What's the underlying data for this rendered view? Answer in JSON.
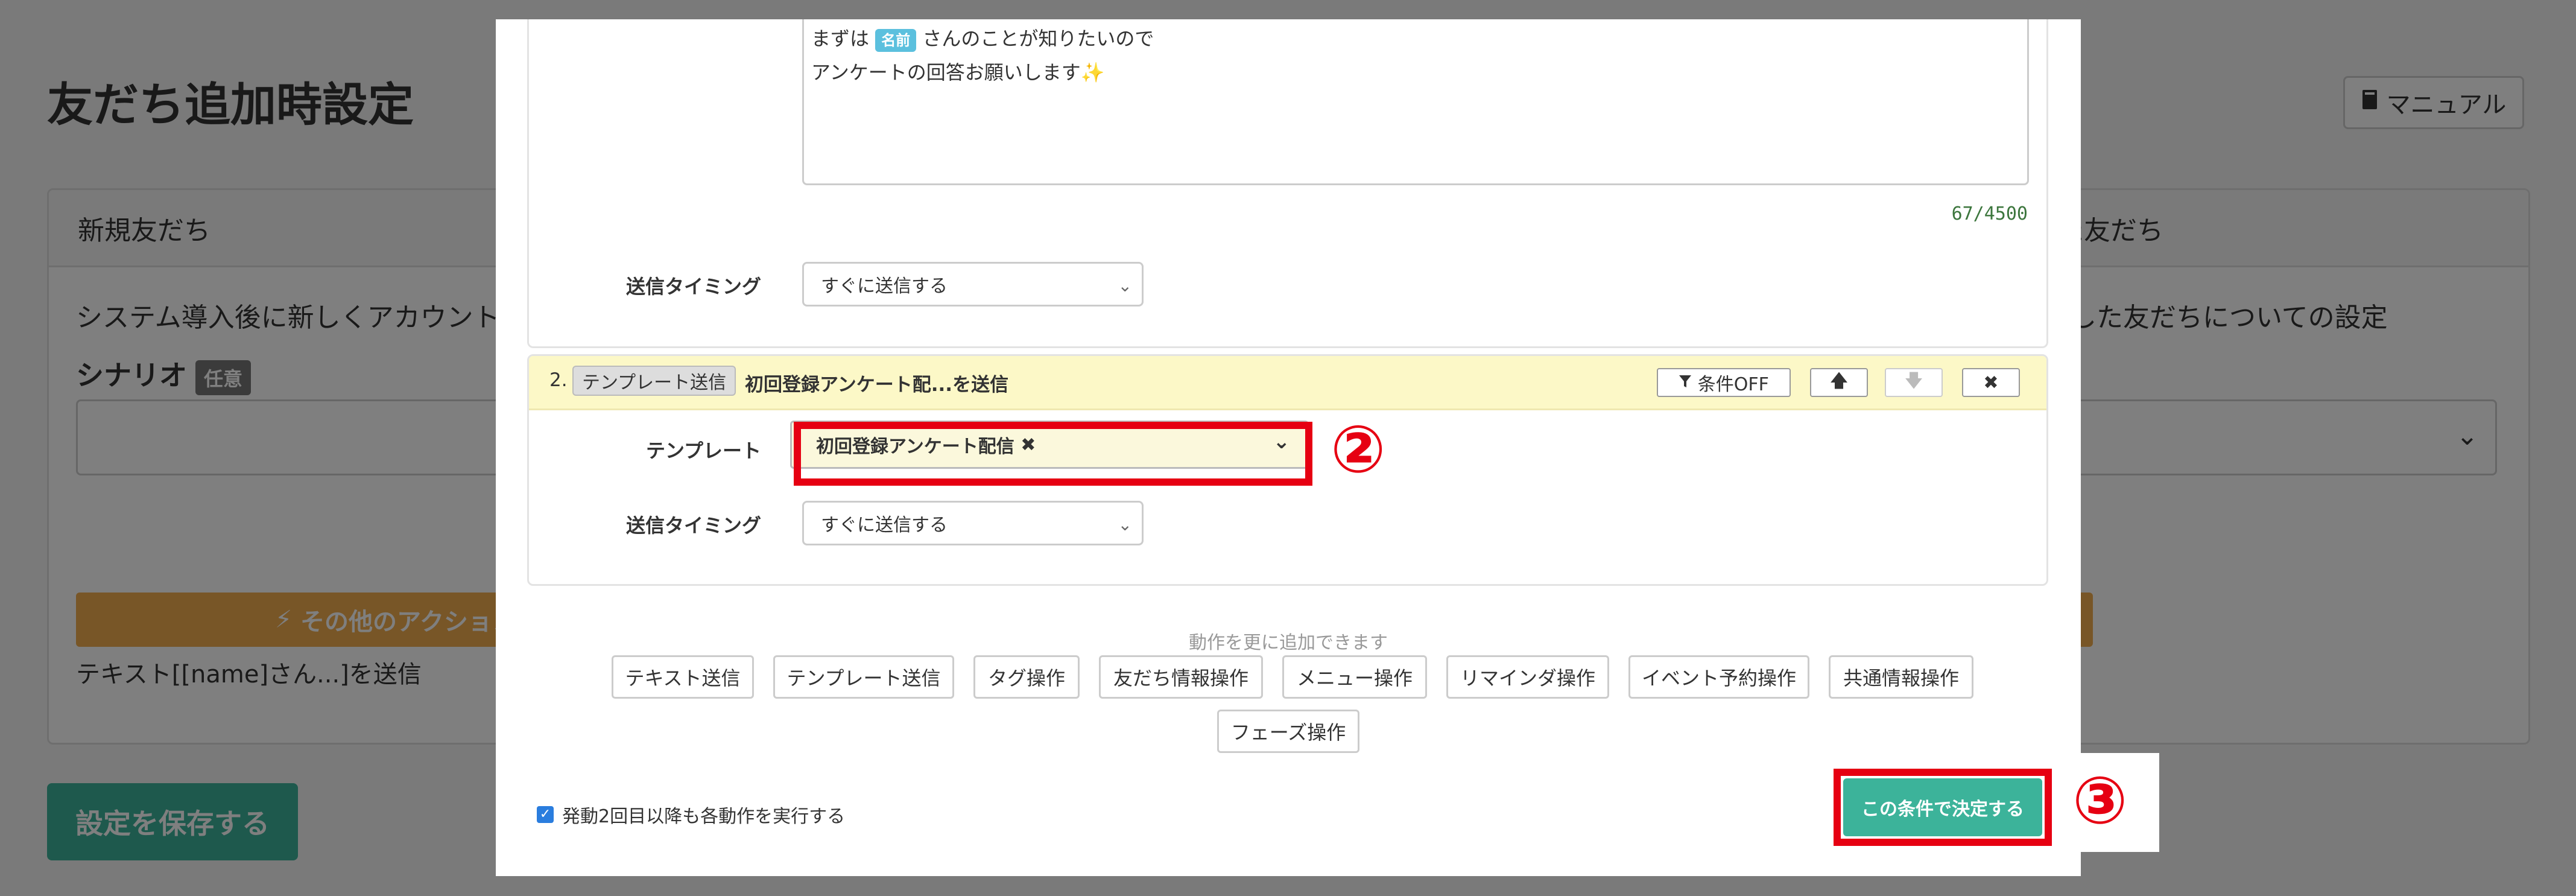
{
  "page": {
    "title": "友だち追加時設定",
    "manual_button": "マニュアル",
    "save_button": "設定を保存する"
  },
  "left_panel": {
    "header": "新規友だち",
    "description": "システム導入後に新しくアカウント",
    "scenario_label": "シナリオ",
    "optional_badge": "任意",
    "other_actions": "その他のアクション",
    "action_summary": "テキスト[[name]さん...]を送信"
  },
  "right_panel": {
    "header": "除した友だち",
    "description": "した友だちについての設定"
  },
  "modal": {
    "message_line1_before": "まずは",
    "name_badge": "名前",
    "message_line1_after": "さんのことが知りたいので",
    "message_line2": "アンケートの回答お願いします✨",
    "char_counter": "67/4500",
    "timing_label": "送信タイミング",
    "timing_value": "すぐに送信する",
    "action2": {
      "number": "2.",
      "type_badge": "テンプレート送信",
      "title": "初回登録アンケート配...を送信",
      "condition_button": "条件OFF",
      "template_label": "テンプレート",
      "template_value": "初回登録アンケート配信",
      "template_remove": "✖",
      "timing_label": "送信タイミング",
      "timing_value": "すぐに送信する"
    },
    "add_hint": "動作を更に追加できます",
    "add_actions": [
      "テキスト送信",
      "テンプレート送信",
      "タグ操作",
      "友だち情報操作",
      "メニュー操作",
      "リマインダ操作",
      "イベント予約操作",
      "共通情報操作"
    ],
    "add_actions_row2": [
      "フェーズ操作"
    ],
    "repeat_checkbox_label": "発動2回目以降も各動作を実行する",
    "decide_button": "この条件で決定する"
  },
  "callouts": {
    "step2": "②",
    "step3": "③"
  },
  "colors": {
    "accent_green": "#3cb39a",
    "highlight_red": "#e60012",
    "name_badge": "#5bc0de",
    "action_header": "#fcf8c7"
  }
}
